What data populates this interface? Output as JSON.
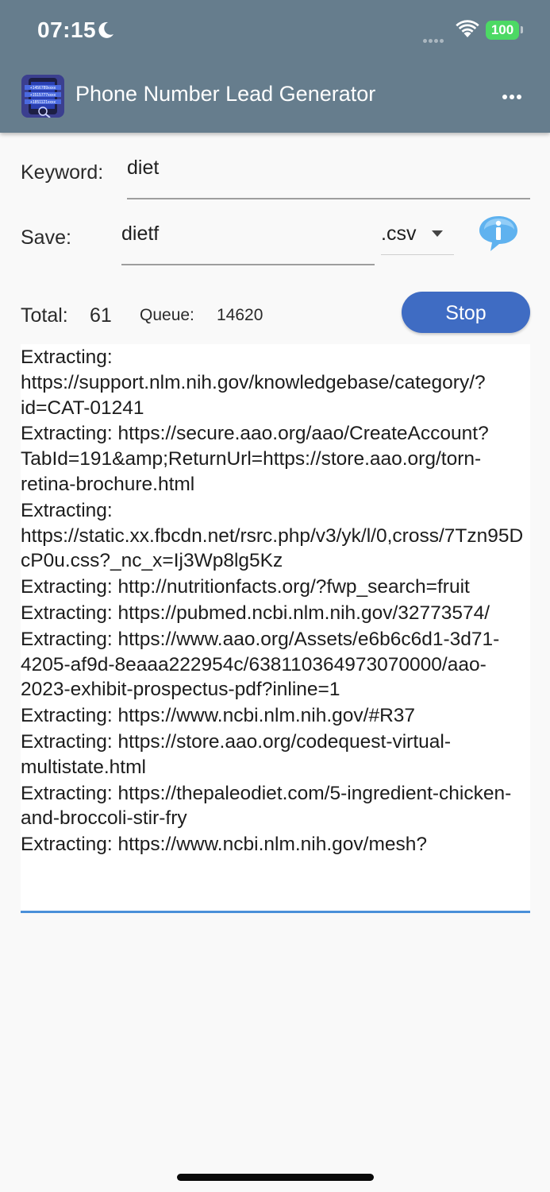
{
  "status_bar": {
    "time": "07:15",
    "battery": "100",
    "icons": [
      "moon-icon",
      "cellular-signal-icon",
      "wifi-icon",
      "battery-icon"
    ]
  },
  "app_bar": {
    "title": "Phone Number Lead Generator",
    "icon_lines": [
      "+1456789xxxx",
      "+1515777xxxx",
      "+1851121xxxx"
    ],
    "menu_icon": "more-horizontal-icon"
  },
  "form": {
    "keyword_label": "Keyword:",
    "keyword_value": "diet",
    "save_label": "Save:",
    "save_value": "dietf",
    "extension": ".csv",
    "info_icon": "info-bubble-icon"
  },
  "stats": {
    "total_label": "Total:",
    "total_value": "61",
    "queue_label": "Queue:",
    "queue_value": "14620"
  },
  "stop_label": "Stop",
  "log": [
    "Extracting: https://support.nlm.nih.gov/knowledgebase/category/?id=CAT-01241",
    "Extracting: https://secure.aao.org/aao/CreateAccount?TabId=191&amp;ReturnUrl=https://store.aao.org/torn-retina-brochure.html",
    "Extracting: https://static.xx.fbcdn.net/rsrc.php/v3/yk/l/0,cross/7Tzn95DcP0u.css?_nc_x=Ij3Wp8lg5Kz",
    "Extracting: http://nutritionfacts.org/?fwp_search=fruit",
    "Extracting: https://pubmed.ncbi.nlm.nih.gov/32773574/",
    "Extracting: https://www.aao.org/Assets/e6b6c6d1-3d71-4205-af9d-8eaaa222954c/638110364973070000/aao-2023-exhibit-prospectus-pdf?inline=1",
    "Extracting: https://www.ncbi.nlm.nih.gov/#R37",
    "Extracting: https://store.aao.org/codequest-virtual-multistate.html",
    "Extracting: https://thepaleodiet.com/5-ingredient-chicken-and-broccoli-stir-fry",
    "Extracting: https://www.ncbi.nlm.nih.gov/mesh?"
  ],
  "colors": {
    "app_bar": "#667d8d",
    "stop_button": "#3f6cc3",
    "log_underline": "#4a90d9",
    "battery": "#4cd964"
  }
}
